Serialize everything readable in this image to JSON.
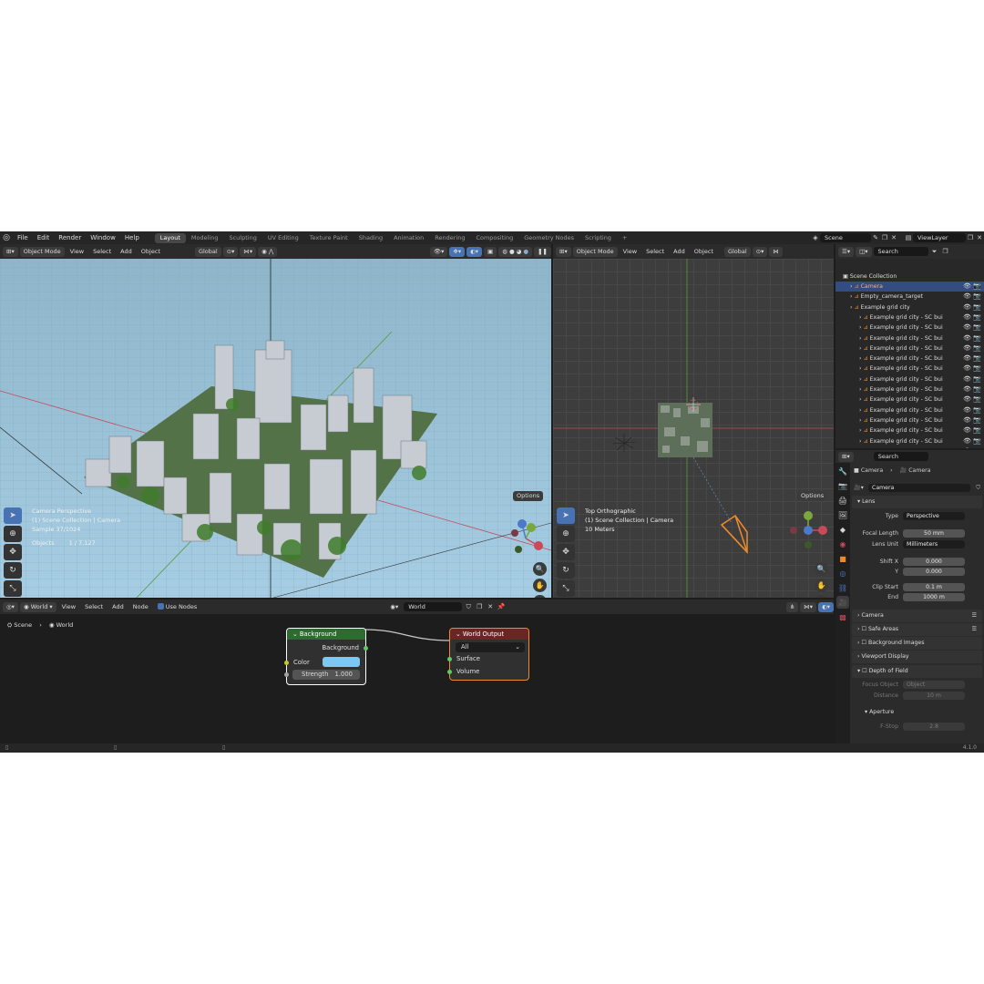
{
  "menu": [
    "File",
    "Edit",
    "Render",
    "Window",
    "Help"
  ],
  "workspaces": [
    "Layout",
    "Modeling",
    "Sculpting",
    "UV Editing",
    "Texture Paint",
    "Shading",
    "Animation",
    "Rendering",
    "Compositing",
    "Geometry Nodes",
    "Scripting"
  ],
  "active_workspace": "Layout",
  "add_tab": "+",
  "scene_name": "Scene",
  "view_layer": "ViewLayer",
  "viewport_left": {
    "mode": "Object Mode",
    "menus": [
      "View",
      "Select",
      "Add",
      "Object"
    ],
    "orientation": "Global",
    "options": "Options",
    "overlay_lines": [
      "Camera Perspective",
      "(1) Scene Collection | Camera",
      "Sample 37/1024"
    ],
    "objects_label": "Objects",
    "objects_count": "1 / 7,127"
  },
  "viewport_right": {
    "mode": "Object Mode",
    "menus": [
      "View",
      "Select",
      "Add",
      "Object"
    ],
    "orientation": "Global",
    "options": "Options",
    "overlay_lines": [
      "Top Orthographic",
      "(1) Scene Collection | Camera",
      "10 Meters"
    ]
  },
  "outliner": {
    "search_placeholder": "Search",
    "root": "Scene Collection",
    "items": [
      {
        "label": "Camera",
        "selected": true,
        "indent": 1
      },
      {
        "label": "Empty_camera_target",
        "selected": false,
        "indent": 1
      },
      {
        "label": "Example grid city",
        "selected": false,
        "indent": 1
      },
      {
        "label": "Example grid city - SC bui",
        "selected": false,
        "indent": 2
      },
      {
        "label": "Example grid city - SC bui",
        "selected": false,
        "indent": 2
      },
      {
        "label": "Example grid city - SC bui",
        "selected": false,
        "indent": 2
      },
      {
        "label": "Example grid city - SC bui",
        "selected": false,
        "indent": 2
      },
      {
        "label": "Example grid city - SC bui",
        "selected": false,
        "indent": 2
      },
      {
        "label": "Example grid city - SC bui",
        "selected": false,
        "indent": 2
      },
      {
        "label": "Example grid city - SC bui",
        "selected": false,
        "indent": 2
      },
      {
        "label": "Example grid city - SC bui",
        "selected": false,
        "indent": 2
      },
      {
        "label": "Example grid city - SC bui",
        "selected": false,
        "indent": 2
      },
      {
        "label": "Example grid city - SC bui",
        "selected": false,
        "indent": 2
      },
      {
        "label": "Example grid city - SC bui",
        "selected": false,
        "indent": 2
      },
      {
        "label": "Example grid city - SC bui",
        "selected": false,
        "indent": 2
      },
      {
        "label": "Example grid city - SC bui",
        "selected": false,
        "indent": 2
      },
      {
        "label": "Example grid city - SC bui",
        "selected": false,
        "indent": 2
      }
    ]
  },
  "properties": {
    "search_placeholder": "Search",
    "breadcrumb": [
      "Camera",
      "Camera"
    ],
    "data_name": "Camera",
    "lens_panel": "Lens",
    "type_label": "Type",
    "type_value": "Perspective",
    "focal_label": "Focal Length",
    "focal_value": "50 mm",
    "lens_unit_label": "Lens Unit",
    "lens_unit_value": "Millimeters",
    "shiftx_label": "Shift X",
    "shiftx_value": "0.000",
    "shifty_label": "Y",
    "shifty_value": "0.000",
    "clipstart_label": "Clip Start",
    "clipstart_value": "0.1 m",
    "clipend_label": "End",
    "clipend_value": "1000 m",
    "panels": [
      "Camera",
      "Safe Areas",
      "Background Images",
      "Viewport Display",
      "Depth of Field"
    ],
    "focus_object_label": "Focus Object",
    "focus_object_placeholder": "Object",
    "distance_label": "Distance",
    "distance_value": "10 m",
    "aperture_panel": "Aperture",
    "fstop_label": "F-Stop",
    "fstop_value": "2.8"
  },
  "node_editor": {
    "editor_type": "World",
    "menus": [
      "View",
      "Select",
      "Add",
      "Node"
    ],
    "use_nodes_label": "Use Nodes",
    "datablock": "World",
    "breadcrumb": [
      "Scene",
      "World"
    ],
    "background_node": {
      "title": "Background",
      "output": "Background",
      "color_label": "Color",
      "color_value": "#7cc8f2",
      "strength_label": "Strength",
      "strength_value": "1.000"
    },
    "output_node": {
      "title": "World Output",
      "target": "All",
      "surface": "Surface",
      "volume": "Volume"
    }
  },
  "status": {
    "version": "4.1.0"
  },
  "colors": {
    "accent": "#4772b3",
    "selection": "#334d80",
    "object_orange": "#ef8a2b",
    "background_node_header": "#2d6b31",
    "output_node_header": "#6b2525",
    "shader_socket": "#63c763",
    "color_socket": "#c7c729"
  }
}
